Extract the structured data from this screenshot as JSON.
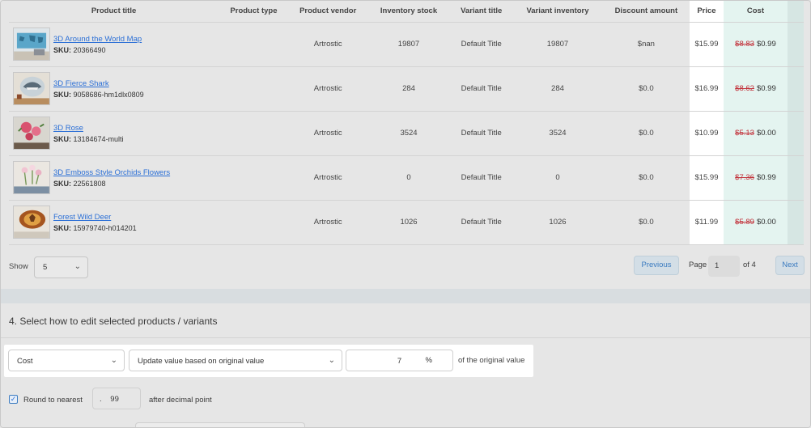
{
  "table": {
    "headers": {
      "product_title": "Product title",
      "product_type": "Product type",
      "product_vendor": "Product vendor",
      "inventory_stock": "Inventory stock",
      "variant_title": "Variant title",
      "variant_inventory": "Variant inventory",
      "discount_amount": "Discount amount",
      "price": "Price",
      "cost": "Cost"
    },
    "sku_label": "SKU:",
    "rows": [
      {
        "title": "3D Around the World Map",
        "sku": "20366490",
        "type": "",
        "vendor": "Artrostic",
        "stock": "19807",
        "variant": "Default Title",
        "variant_inventory": "19807",
        "discount": "$nan",
        "price": "$15.99",
        "cost_old": "$8.83",
        "cost_new": "$0.99"
      },
      {
        "title": "3D Fierce Shark",
        "sku": "9058686-hm1dlx0809",
        "type": "",
        "vendor": "Artrostic",
        "stock": "284",
        "variant": "Default Title",
        "variant_inventory": "284",
        "discount": "$0.0",
        "price": "$16.99",
        "cost_old": "$8.62",
        "cost_new": "$0.99"
      },
      {
        "title": "3D Rose",
        "sku": "13184674-multi",
        "type": "",
        "vendor": "Artrostic",
        "stock": "3524",
        "variant": "Default Title",
        "variant_inventory": "3524",
        "discount": "$0.0",
        "price": "$10.99",
        "cost_old": "$5.13",
        "cost_new": "$0.00"
      },
      {
        "title": "3D Emboss Style Orchids Flowers",
        "sku": "22561808",
        "type": "",
        "vendor": "Artrostic",
        "stock": "0",
        "variant": "Default Title",
        "variant_inventory": "0",
        "discount": "$0.0",
        "price": "$15.99",
        "cost_old": "$7.36",
        "cost_new": "$0.99"
      },
      {
        "title": "Forest Wild Deer",
        "sku": "15979740-h014201",
        "type": "",
        "vendor": "Artrostic",
        "stock": "1026",
        "variant": "Default Title",
        "variant_inventory": "1026",
        "discount": "$0.0",
        "price": "$11.99",
        "cost_old": "$5.89",
        "cost_new": "$0.00"
      }
    ]
  },
  "pager": {
    "show_label": "Show",
    "show_value": "5",
    "previous_label": "Previous",
    "page_label": "Page",
    "page_value": "1",
    "of_label": "of 4",
    "next_label": "Next"
  },
  "edit_section": {
    "title": "4. Select how to edit selected products / variants",
    "field_value": "Cost",
    "mode_value": "Update value based on original value",
    "amount_value": "7",
    "unit": "%",
    "suffix": "of the original value",
    "round_label": "Round to nearest",
    "round_dot": ".",
    "round_value": "99",
    "after_label": "after decimal point",
    "round_checked": true
  },
  "colors": {
    "link": "#2b6fd6",
    "strike": "#c2313a",
    "price_bg": "#ffffff",
    "cost_bg": "#e4f4f0",
    "button_bg": "#d3dee6"
  }
}
